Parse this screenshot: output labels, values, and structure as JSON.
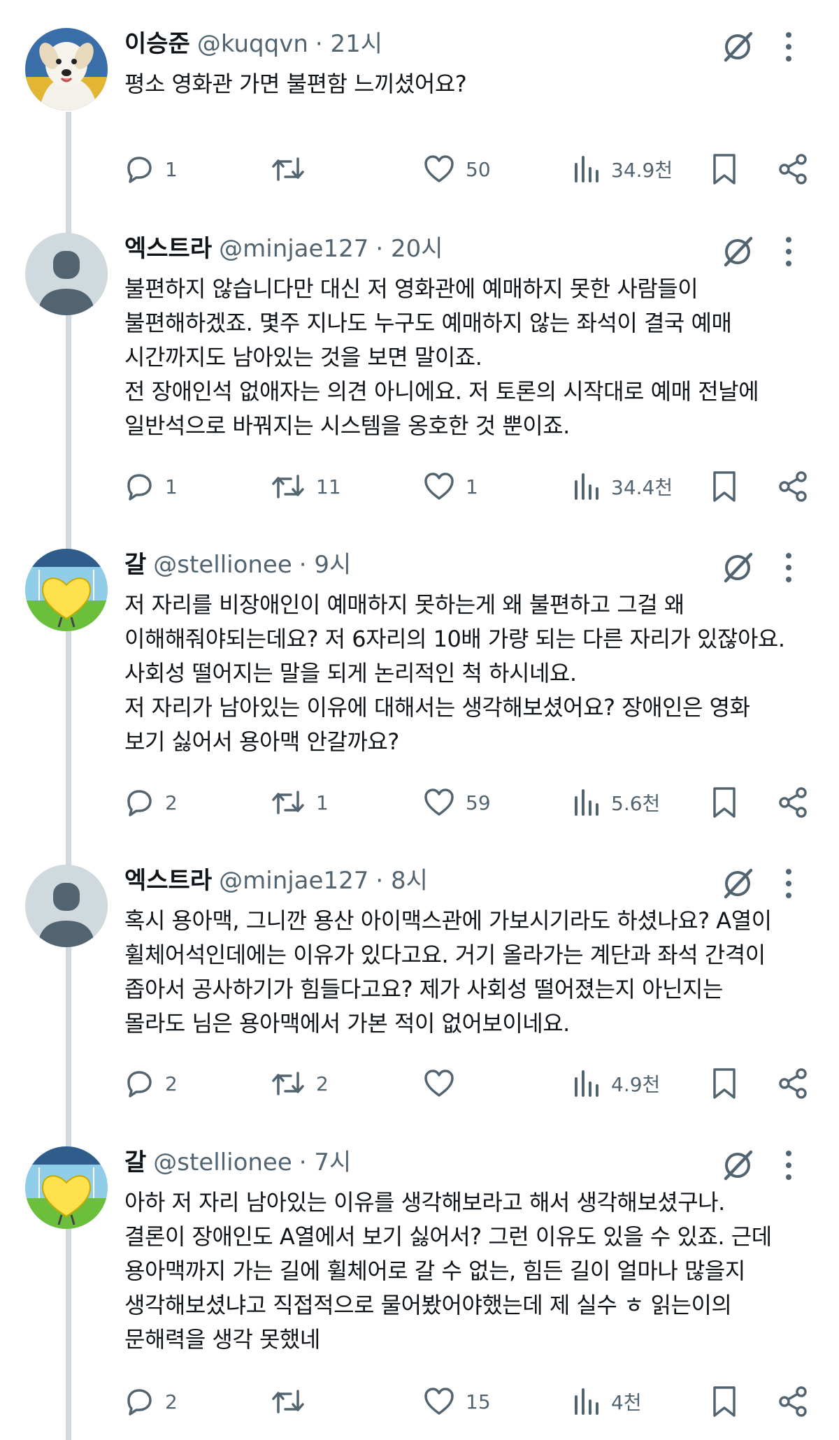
{
  "colors": {
    "text": "#0f1419",
    "muted": "#536471",
    "thread_line": "#cfd9de"
  },
  "tweets": [
    {
      "name": "이승준",
      "handle": "@kuqqvn",
      "time": "· 21시",
      "avatar": "dog-photo",
      "text": "평소 영화관 가면 불편함 느끼셨어요?",
      "reply_count": "1",
      "retweet_count": "",
      "like_count": "50",
      "view_count": "34.9천"
    },
    {
      "name": "엑스트라",
      "handle": "@minjae127",
      "time": "· 20시",
      "avatar": "default-profile",
      "text": "불편하지 않습니다만 대신 저 영화관에 예매하지 못한 사람들이\n불편해하겠죠. 몇주 지나도 누구도 예매하지 않는 좌석이 결국 예매\n시간까지도 남아있는 것을 보면 말이죠.\n전 장애인석 없애자는 의견 아니에요. 저 토론의 시작대로 예매 전날에\n일반석으로 바꿔지는 시스템을 옹호한 것 뿐이죠.",
      "reply_count": "1",
      "retweet_count": "11",
      "like_count": "1",
      "view_count": "34.4천"
    },
    {
      "name": "갈",
      "handle": "@stellionee",
      "time": "· 9시",
      "avatar": "heart-character",
      "text": "저 자리를 비장애인이 예매하지 못하는게 왜 불편하고 그걸 왜\n이해해줘야되는데요? 저 6자리의 10배 가량 되는 다른 자리가 있잖아요.\n사회성 떨어지는 말을 되게 논리적인 척 하시네요.\n저 자리가 남아있는 이유에 대해서는 생각해보셨어요? 장애인은 영화\n보기 싫어서 용아맥 안갈까요?",
      "reply_count": "2",
      "retweet_count": "1",
      "like_count": "59",
      "view_count": "5.6천"
    },
    {
      "name": "엑스트라",
      "handle": "@minjae127",
      "time": "· 8시",
      "avatar": "default-profile",
      "text": "혹시 용아맥, 그니깐 용산 아이맥스관에 가보시기라도 하셨나요? A열이\n휠체어석인데에는 이유가 있다고요. 거기 올라가는 계단과 좌석 간격이\n좁아서 공사하기가 힘들다고요? 제가 사회성 떨어졌는지 아닌지는\n몰라도 님은 용아맥에서 가본 적이 없어보이네요.",
      "reply_count": "2",
      "retweet_count": "2",
      "like_count": "",
      "view_count": "4.9천"
    },
    {
      "name": "갈",
      "handle": "@stellionee",
      "time": "· 7시",
      "avatar": "heart-character",
      "text": "아하 저 자리 남아있는 이유를 생각해보라고 해서 생각해보셨구나.\n결론이 장애인도 A열에서 보기 싫어서? 그런 이유도 있을 수 있죠. 근데\n용아맥까지 가는 길에 휠체어로 갈 수 없는, 힘든 길이 얼마나 많을지\n생각해보셨냐고 직접적으로 물어봤어야했는데 제 실수 ㅎ 읽는이의\n문해력을 생각 못했네",
      "reply_count": "2",
      "retweet_count": "",
      "like_count": "15",
      "view_count": "4천"
    }
  ]
}
